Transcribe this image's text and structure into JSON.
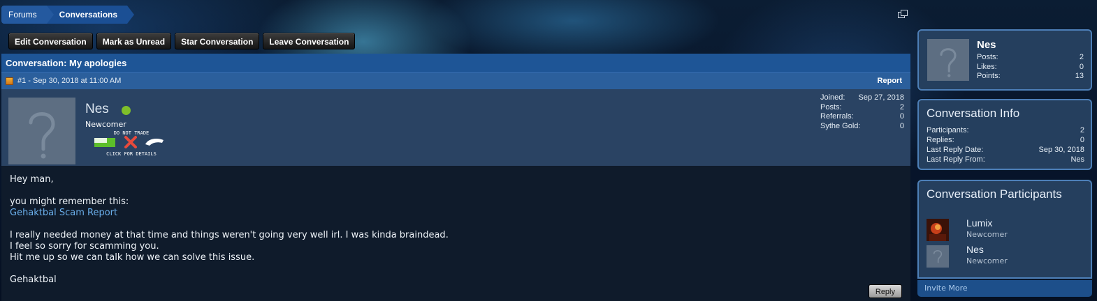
{
  "breadcrumb": {
    "items": [
      "Forums",
      "Conversations"
    ]
  },
  "actions": {
    "edit": "Edit Conversation",
    "mark_unread": "Mark as Unread",
    "star": "Star Conversation",
    "leave": "Leave Conversation"
  },
  "conversation": {
    "title": "Conversation: My apologies",
    "message_meta": "#1 - Sep 30, 2018 at 11:00 AM",
    "report": "Report",
    "author": {
      "name": "Nes",
      "status_color": "#7fbf2a",
      "title": "Newcomer",
      "badge": {
        "top": "DO NOT TRADE",
        "bottom": "CLICK FOR DETAILS"
      },
      "stats": [
        {
          "label": "Joined:",
          "value": "Sep 27, 2018"
        },
        {
          "label": "Posts:",
          "value": "2"
        },
        {
          "label": "Referrals:",
          "value": "0"
        },
        {
          "label": "Sythe Gold:",
          "value": "0"
        }
      ]
    },
    "body": {
      "greeting": "Hey man,",
      "line1": "you might remember this:",
      "link": "Gehaktbal Scam Report",
      "line2": "I really needed money at that time and things weren't going very well irl. I was kinda braindead.",
      "line3": "I feel so sorry for scamming you.",
      "line4": "Hit me up so we can talk how we can solve this issue.",
      "signature": "Gehaktbal"
    },
    "reply": "Reply"
  },
  "sidebar": {
    "user": {
      "name": "Nes",
      "stats": [
        {
          "label": "Posts:",
          "value": "2"
        },
        {
          "label": "Likes:",
          "value": "0"
        },
        {
          "label": "Points:",
          "value": "13"
        }
      ]
    },
    "info": {
      "heading": "Conversation Info",
      "rows": [
        {
          "label": "Participants:",
          "value": "2"
        },
        {
          "label": "Replies:",
          "value": "0"
        },
        {
          "label": "Last Reply Date:",
          "value": "Sep 30, 2018"
        },
        {
          "label": "Last Reply From:",
          "value": "Nes"
        }
      ]
    },
    "participants": {
      "heading": "Conversation Participants",
      "list": [
        {
          "name": "Lumix",
          "title": "Newcomer"
        },
        {
          "name": "Nes",
          "title": "Newcomer"
        }
      ]
    },
    "invite": "Invite More"
  },
  "colors": {
    "accent": "#1e5596",
    "panel": "#2a4363",
    "body_bg": "#0f1b2b",
    "link": "#6aaeea",
    "online": "#7fbf2a",
    "dnt_red": "#e84a3c",
    "dnt_green": "#5cbf2a"
  }
}
